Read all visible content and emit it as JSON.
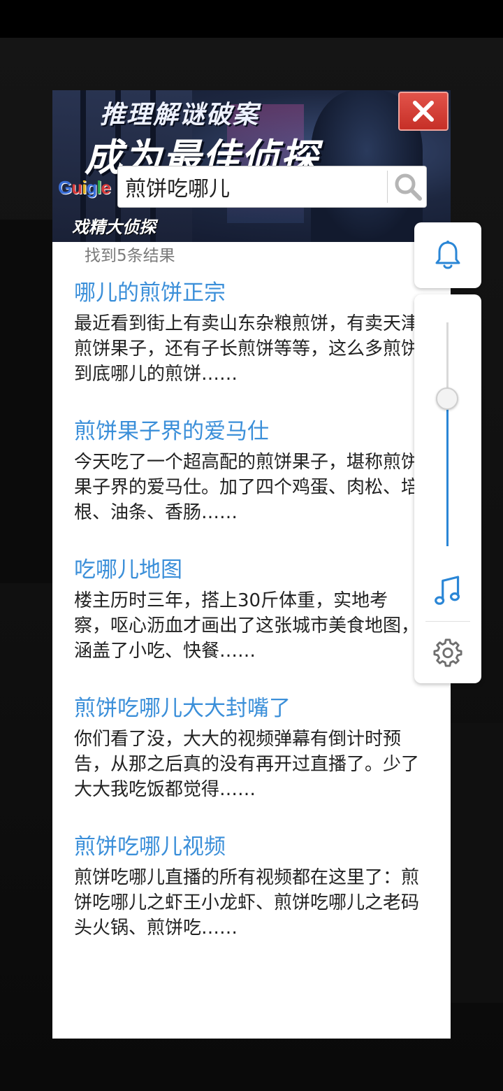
{
  "banner": {
    "tagline": "推理解谜破案",
    "headline": "成为最佳侦探",
    "game_name": "戏精大侦探"
  },
  "logo": {
    "letters": [
      {
        "char": "G",
        "color": "#3a6fd8"
      },
      {
        "char": "u",
        "color": "#d83a3a"
      },
      {
        "char": "i",
        "color": "#e6b422"
      },
      {
        "char": "g",
        "color": "#3a6fd8"
      },
      {
        "char": "l",
        "color": "#2fa84f"
      },
      {
        "char": "e",
        "color": "#d83a3a"
      }
    ]
  },
  "search": {
    "query": "煎饼吃哪儿",
    "result_count_text": "找到5条结果"
  },
  "results": [
    {
      "title": "哪儿的煎饼正宗",
      "snippet": "最近看到街上有卖山东杂粮煎饼，有卖天津煎饼果子，还有子长煎饼等等，这么多煎饼到底哪儿的煎饼……"
    },
    {
      "title": "煎饼果子界的爱马仕",
      "snippet": "今天吃了一个超高配的煎饼果子，堪称煎饼果子界的爱马仕。加了四个鸡蛋、肉松、培根、油条、香肠……"
    },
    {
      "title": "吃哪儿地图",
      "snippet": "楼主历时三年，搭上30斤体重，实地考察，呕心沥血才画出了这张城市美食地图，涵盖了小吃、快餐……"
    },
    {
      "title": "煎饼吃哪儿大大封嘴了",
      "snippet": "你们看了没，大大的视频弹幕有倒计时预告，从那之后真的没有再开过直播了。少了大大我吃饭都觉得……"
    },
    {
      "title": "煎饼吃哪儿视频",
      "snippet": "煎饼吃哪儿直播的所有视频都在这里了：煎饼吃哪儿之虾王小龙虾、煎饼吃哪儿之老码头火锅、煎饼吃……"
    }
  ],
  "side_panel": {
    "volume_level": 0.66,
    "accent_color": "#2a86d6",
    "icons": [
      "bell-icon",
      "music-note-icon",
      "gear-icon"
    ]
  },
  "colors": {
    "link": "#3b8fd9",
    "close_button": "#d9443b"
  }
}
